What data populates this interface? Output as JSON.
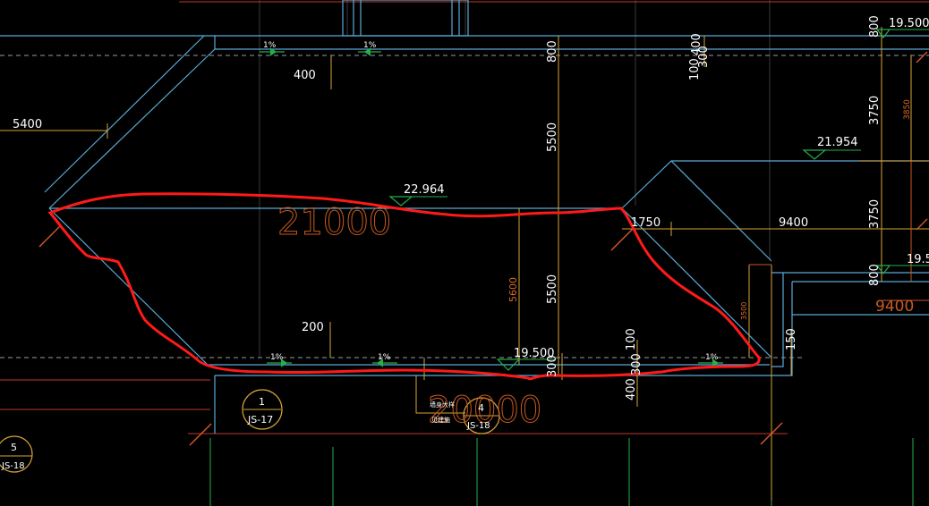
{
  "palette": {
    "background": "#000000",
    "wall_line": "#5aa9d6",
    "dimension_line": "#d8a33a",
    "grid_line": "#22b14c",
    "axis_line": "#c0392b",
    "markup_red": "#ff1a1a",
    "text": "#ffffff",
    "orange_text": "#d86a2a"
  },
  "elevations": {
    "top_right": "19.500",
    "mid_right": "21.954",
    "center_roof": "22.964",
    "bottom_center": "19.500",
    "right_cut": "19.5"
  },
  "dimensions": {
    "left_span": "5400",
    "top_400": "400",
    "top_800": "800",
    "top_400b": "400",
    "top_100": "100",
    "top_300": "300",
    "height_5500_top": "5500",
    "height_5500_bottom": "5500",
    "height_5600": "5600",
    "right_3750_top": "3750",
    "right_3750_bottom": "3750",
    "right_3850": "3850",
    "right_800_top": "800",
    "right_800_mid": "800",
    "span_1750": "1750",
    "span_9400": "9400",
    "span_9400_big": "9400",
    "width_21000": "21000",
    "bottom_dim_big": "20000",
    "dim_200": "200",
    "dim_3500": "3500",
    "dim_150": "150",
    "bottom_400": "400",
    "bottom_300": "300",
    "bottom_300b": "300",
    "bottom_100": "100"
  },
  "slopes": {
    "s1": "1%",
    "s2": "1%",
    "s3": "1%",
    "s4": "1%",
    "s5": "1%"
  },
  "detail_callouts": [
    {
      "number": "1",
      "sheet": "JS-17"
    },
    {
      "number": "4",
      "sheet": "JS-18"
    },
    {
      "number": "5",
      "sheet": "JS-18"
    }
  ],
  "tags": {
    "line1": "墙身大样",
    "line2": "见建施"
  }
}
